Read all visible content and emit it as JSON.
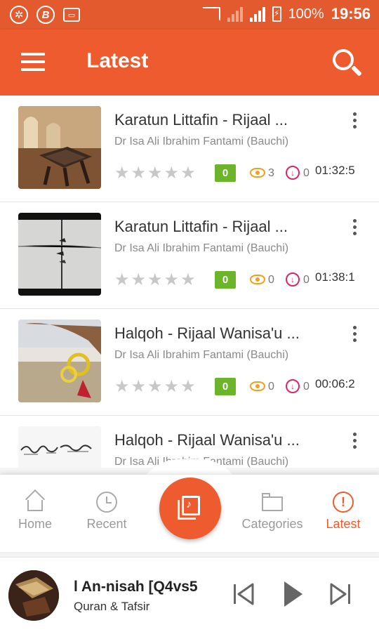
{
  "status_bar": {
    "battery": "100%",
    "time": "19:56"
  },
  "app_bar": {
    "title": "Latest"
  },
  "items": [
    {
      "title": "Karatun Littafin - Rijaal ...",
      "author": "Dr Isa Ali Ibrahim Fantami (Bauchi)",
      "stars": "★★★★★",
      "rating_count": "0",
      "views": "3",
      "downloads": "0",
      "duration": "01:32:5"
    },
    {
      "title": "Karatun Littafin - Rijaal ...",
      "author": "Dr Isa Ali Ibrahim Fantami (Bauchi)",
      "stars": "★★★★★",
      "rating_count": "0",
      "views": "0",
      "downloads": "0",
      "duration": "01:38:1"
    },
    {
      "title": "Halqoh - Rijaal Wanisa'u ...",
      "author": "Dr Isa Ali Ibrahim Fantami (Bauchi)",
      "stars": "★★★★★",
      "rating_count": "0",
      "views": "0",
      "downloads": "0",
      "duration": "00:06:2"
    },
    {
      "title": "Halqoh - Rijaal Wanisa'u ...",
      "author": "Dr Isa Ali Ibrahim Fantami (Bauchi)"
    }
  ],
  "bottom_nav": {
    "home": "Home",
    "recent": "Recent",
    "categories": "Categories",
    "latest": "Latest"
  },
  "player": {
    "title": "l An-nisah [Q4vs5",
    "subtitle": "Quran & Tafsir"
  },
  "colors": {
    "accent": "#ee5b2f",
    "status_bar": "#e35a2e",
    "rating_badge": "#6cb52b",
    "views": "#f0a020",
    "downloads": "#d4276e"
  }
}
